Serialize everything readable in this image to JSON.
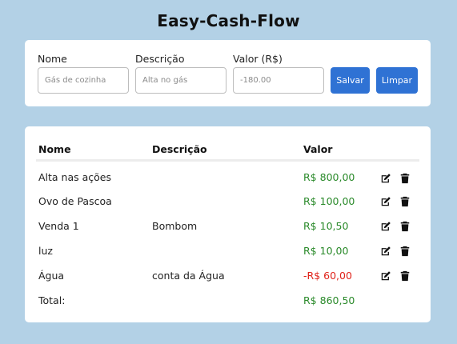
{
  "app": {
    "title": "Easy-Cash-Flow"
  },
  "form": {
    "nome": {
      "label": "Nome",
      "placeholder": "Gás de cozinha",
      "value": ""
    },
    "descricao": {
      "label": "Descrição",
      "placeholder": "Alta no gás",
      "value": ""
    },
    "valor": {
      "label": "Valor (R$)",
      "placeholder": "-180.00",
      "value": ""
    },
    "save_label": "Salvar",
    "clear_label": "Limpar"
  },
  "table": {
    "headers": {
      "nome": "Nome",
      "descricao": "Descrição",
      "valor": "Valor"
    },
    "rows": [
      {
        "nome": "Alta nas ações",
        "descricao": "",
        "valor": "R$ 800,00",
        "sign": "positive"
      },
      {
        "nome": "Ovo de Pascoa",
        "descricao": "",
        "valor": "R$ 100,00",
        "sign": "positive"
      },
      {
        "nome": "Venda 1",
        "descricao": "Bombom",
        "valor": "R$ 10,50",
        "sign": "positive"
      },
      {
        "nome": "luz",
        "descricao": "",
        "valor": "R$ 10,00",
        "sign": "positive"
      },
      {
        "nome": "Água",
        "descricao": "conta da Água",
        "valor": "-R$ 60,00",
        "sign": "negative"
      }
    ],
    "total": {
      "label": "Total:",
      "value": "R$ 860,50"
    },
    "row_icons": [
      "edit-icon",
      "trash-icon"
    ]
  },
  "colors": {
    "background": "#b3d1e6",
    "button": "#2f72d4",
    "positive": "#2a8a2a",
    "negative": "#e0241b"
  }
}
